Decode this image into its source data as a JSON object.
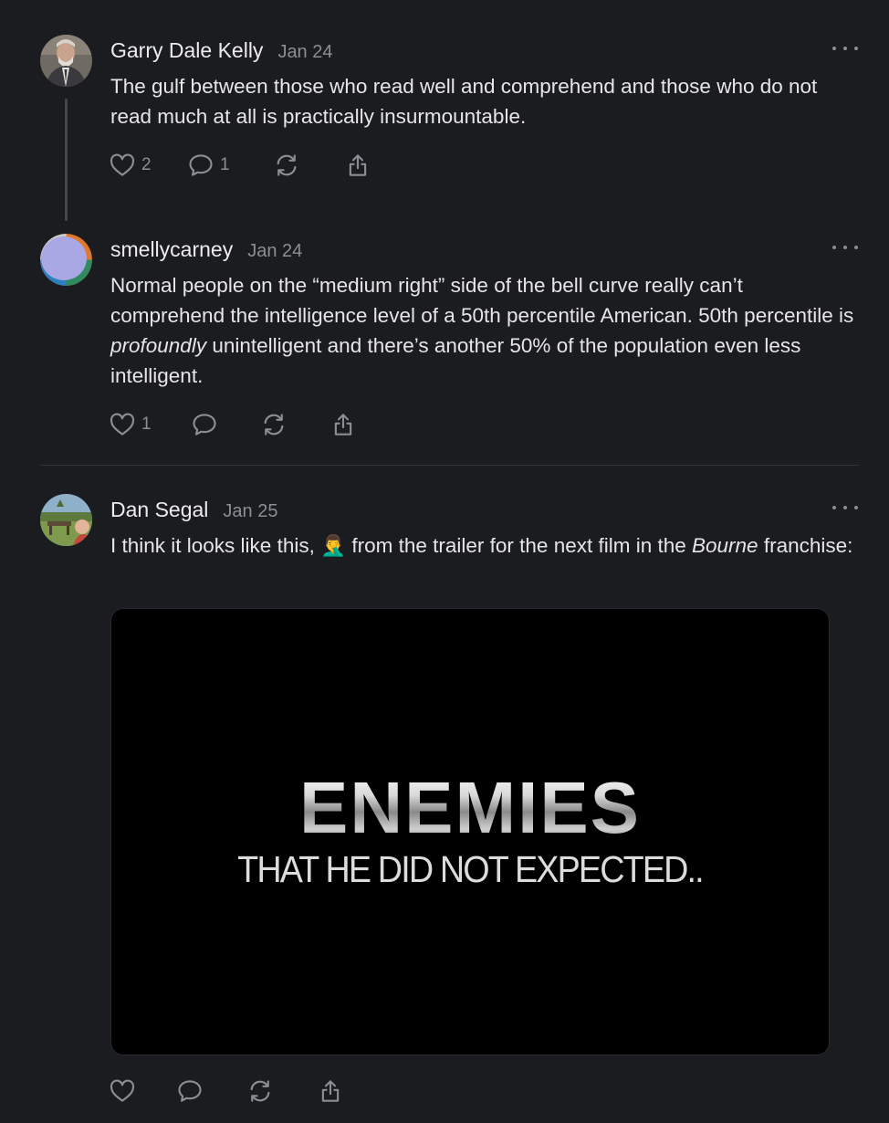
{
  "comments": [
    {
      "author": "Garry Dale Kelly",
      "date": "Jan 24",
      "text": "The gulf between those who read well and comprehend and those who do not read much at all is practically insurmountable.",
      "likes": "2",
      "replies": "1"
    },
    {
      "author": "smellycarney",
      "date": "Jan 24",
      "text_before": "Normal people on the “medium right” side of the bell curve really can’t comprehend the intelligence level of a 50th percentile American. 50th percentile is ",
      "text_em": "profoundly",
      "text_after": " unintelligent and there’s another 50% of the population even less intelligent.",
      "likes": "1"
    },
    {
      "author": "Dan Segal",
      "date": "Jan 25",
      "text_before": "I think it looks like this, ",
      "emoji": "🤦‍♂️",
      "text_mid": " from the trailer for the next film in the ",
      "text_em": "Bourne",
      "text_after": " franchise:",
      "media": {
        "title": "ENEMIES",
        "subtitle": "THAT HE DID NOT EXPECTED.."
      }
    }
  ],
  "icons": {
    "more": "more-options-icon",
    "like": "heart-icon",
    "reply": "comment-bubble-icon",
    "restack": "restack-icon",
    "share": "share-icon"
  },
  "colors": {
    "background": "#1b1c1f",
    "text": "#e6e6e8",
    "muted": "#8d8e93"
  }
}
